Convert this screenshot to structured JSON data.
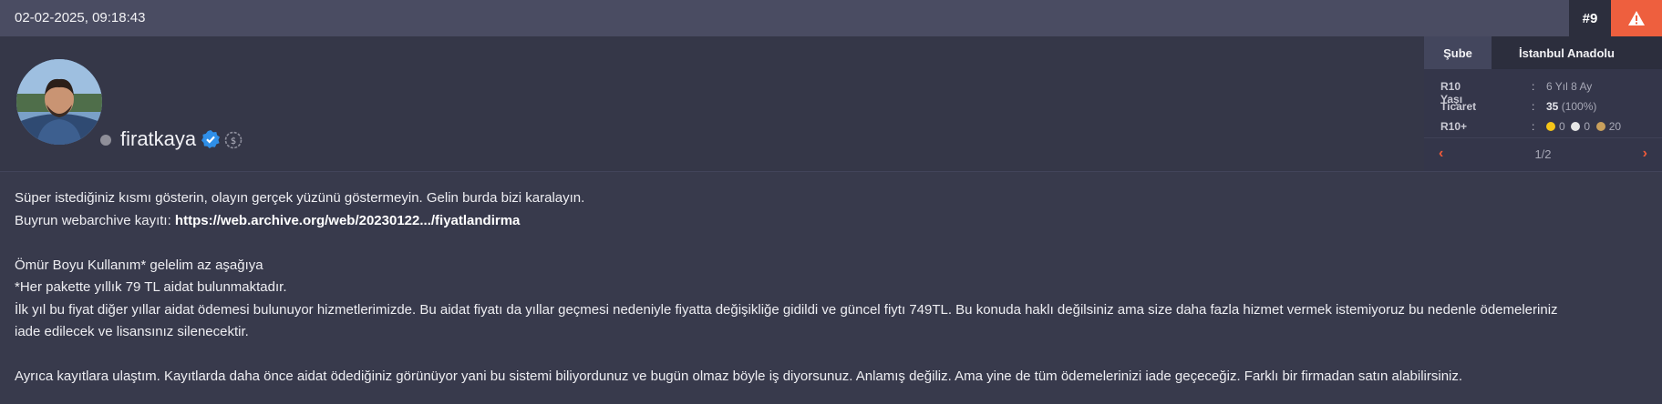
{
  "post": {
    "date": "02-02-2025, 09:18:43",
    "number": "#9"
  },
  "user": {
    "name": "firatkaya",
    "online_status": "offline",
    "verified_icon": "verified-badge-icon",
    "badge_icon": "dollar-badge-icon"
  },
  "info": {
    "tab_label": "Şube",
    "tab_value": "İstanbul Anadolu",
    "rows": [
      {
        "label": "R10 Yaşı",
        "value": "6 Yıl 8 Ay"
      },
      {
        "label": "Ticaret",
        "value_bold": "35",
        "value_rest": "(100%)"
      },
      {
        "label": "R10+",
        "gold": "0",
        "silver": "0",
        "bronze": "20"
      }
    ],
    "page": "1/2",
    "colors": {
      "gold": "#f5c518",
      "silver": "#e6e6e6",
      "bronze": "#c9a05c"
    }
  },
  "content": {
    "line1": "Süper istediğiniz kısmı gösterin, olayın gerçek yüzünü göstermeyin. Gelin burda bizi karalayın.",
    "line2_prefix": "Buyrun webarchive kayıtı: ",
    "line2_link": "https://web.archive.org/web/20230122.../fiyatlandirma",
    "line3": "Ömür Boyu Kullanım* gelelim az aşağıya",
    "line4": "*Her pakette yıllık 79 TL aidat bulunmaktadır.",
    "line5": "İlk yıl bu fiyat diğer yıllar aidat ödemesi bulunuyor hizmetlerimizde. Bu aidat fiyatı da yıllar geçmesi nedeniyle fiyatta değişikliğe gidildi ve güncel fiytı 749TL. Bu konuda haklı değilsiniz ama size daha fazla hizmet vermek istemiyoruz bu nedenle ödemeleriniz",
    "line6": "iade edilecek ve lisansınız silenecektir.",
    "line7": "Ayrıca kayıtlara ulaştım. Kayıtlarda daha önce aidat ödediğiniz görünüyor yani bu sistemi biliyordunuz ve bugün olmaz böyle iş diyorsunuz. Anlamış değiliz. Ama yine de tüm ödemelerinizi iade geçeceğiz. Farklı bir firmadan satın alabilirsiniz."
  },
  "colors": {
    "accent": "#ee5f3e",
    "background": "#383a4c"
  }
}
